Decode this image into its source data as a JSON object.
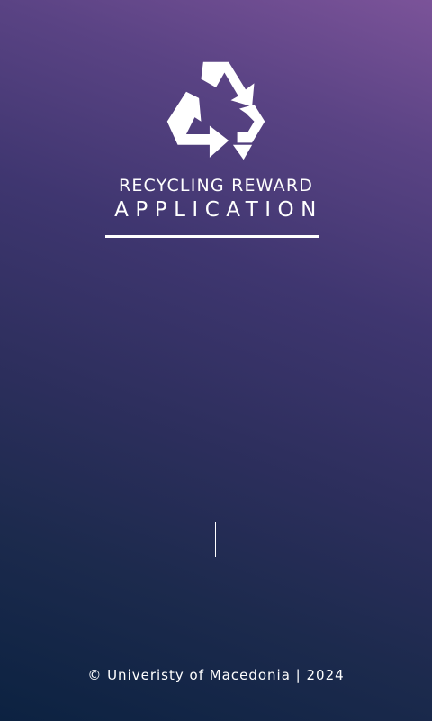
{
  "app": {
    "logo_icon": "recycle-icon",
    "title_line1": "RECYCLING REWARD",
    "title_line2": "APPLICATION",
    "loading_icon": "loading-indicator"
  },
  "footer": {
    "copyright": "© Univeristy of Macedonia | 2024"
  },
  "colors": {
    "gradient_top": "#7b5399",
    "gradient_bottom": "#0c2241",
    "foreground": "#ffffff"
  }
}
